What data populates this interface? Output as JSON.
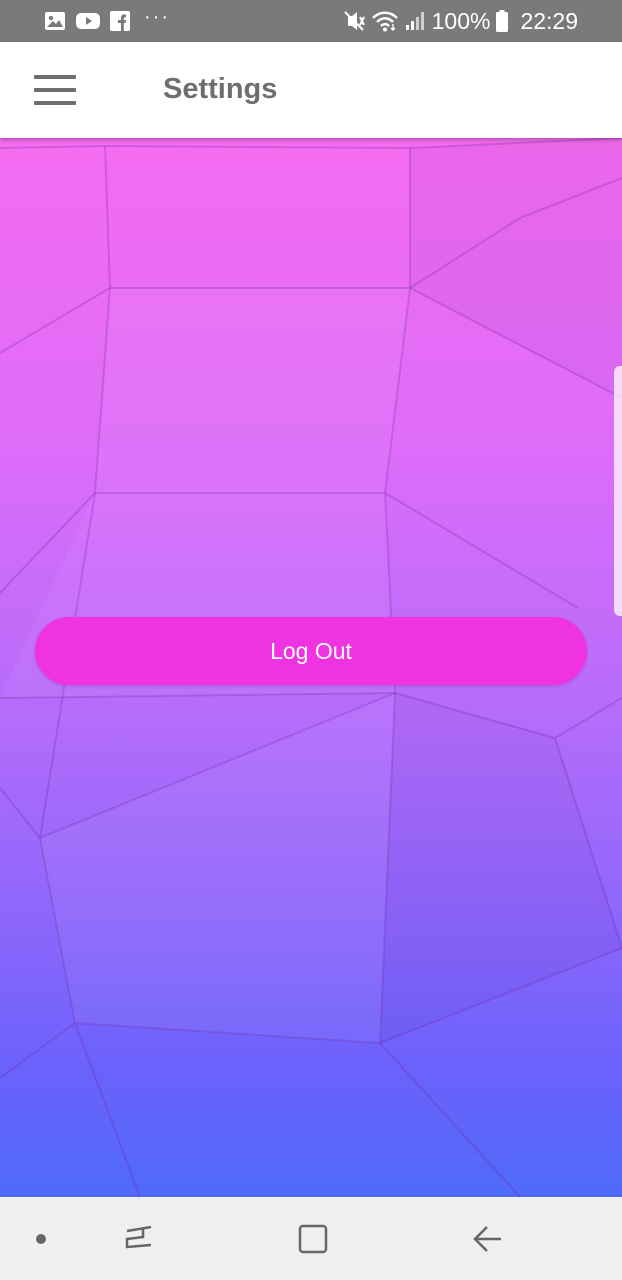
{
  "status_bar": {
    "notification_icons": [
      "gallery-icon",
      "youtube-icon",
      "facebook-icon"
    ],
    "more": "···",
    "battery": "100%",
    "time": "22:29"
  },
  "app_bar": {
    "title": "Settings"
  },
  "content": {
    "logout_label": "Log Out"
  },
  "colors": {
    "status_bar": "#7a7a7a",
    "app_bar": "#ffffff",
    "title_text": "#6e6e6e",
    "logout_button": "#ef33e0",
    "gradient_top": "#f56cf0",
    "gradient_bottom": "#4f6af9",
    "nav_bar": "#efefef"
  },
  "nav_bar": {
    "buttons": [
      "dot-icon",
      "recent-apps-icon",
      "home-icon",
      "back-icon"
    ]
  }
}
